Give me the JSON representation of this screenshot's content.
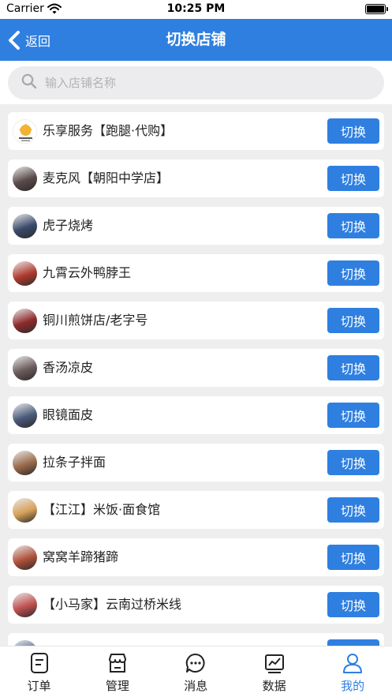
{
  "status_bar": {
    "carrier": "Carrier",
    "time": "10:25 PM"
  },
  "nav": {
    "back_label": "返回",
    "title": "切换店铺"
  },
  "search": {
    "placeholder": "输入店铺名称"
  },
  "switch_label": "切换",
  "stores": [
    {
      "name": "乐享服务【跑腿·代购】",
      "thumb": "logo"
    },
    {
      "name": "麦克风【朝阳中学店】",
      "thumb": "photo"
    },
    {
      "name": "虎子烧烤",
      "thumb": "photo"
    },
    {
      "name": "九霄云外鸭脖王",
      "thumb": "photo"
    },
    {
      "name": "铜川煎饼店/老字号",
      "thumb": "photo"
    },
    {
      "name": "香汤凉皮",
      "thumb": "photo"
    },
    {
      "name": "眼镜面皮",
      "thumb": "photo"
    },
    {
      "name": "拉条子拌面",
      "thumb": "photo"
    },
    {
      "name": "【江江】米饭·面食馆",
      "thumb": "photo"
    },
    {
      "name": "窝窝羊蹄猪蹄",
      "thumb": "photo"
    },
    {
      "name": "【小马家】云南过桥米线",
      "thumb": "photo"
    },
    {
      "name": "",
      "thumb": "photo"
    }
  ],
  "tabs": [
    {
      "label": "订单",
      "icon": "order-icon",
      "active": false
    },
    {
      "label": "管理",
      "icon": "store-icon",
      "active": false
    },
    {
      "label": "消息",
      "icon": "message-icon",
      "active": false
    },
    {
      "label": "数据",
      "icon": "chart-icon",
      "active": false
    },
    {
      "label": "我的",
      "icon": "user-icon",
      "active": true
    }
  ],
  "colors": {
    "primary": "#2f7fe0",
    "background": "#eeeeee"
  }
}
